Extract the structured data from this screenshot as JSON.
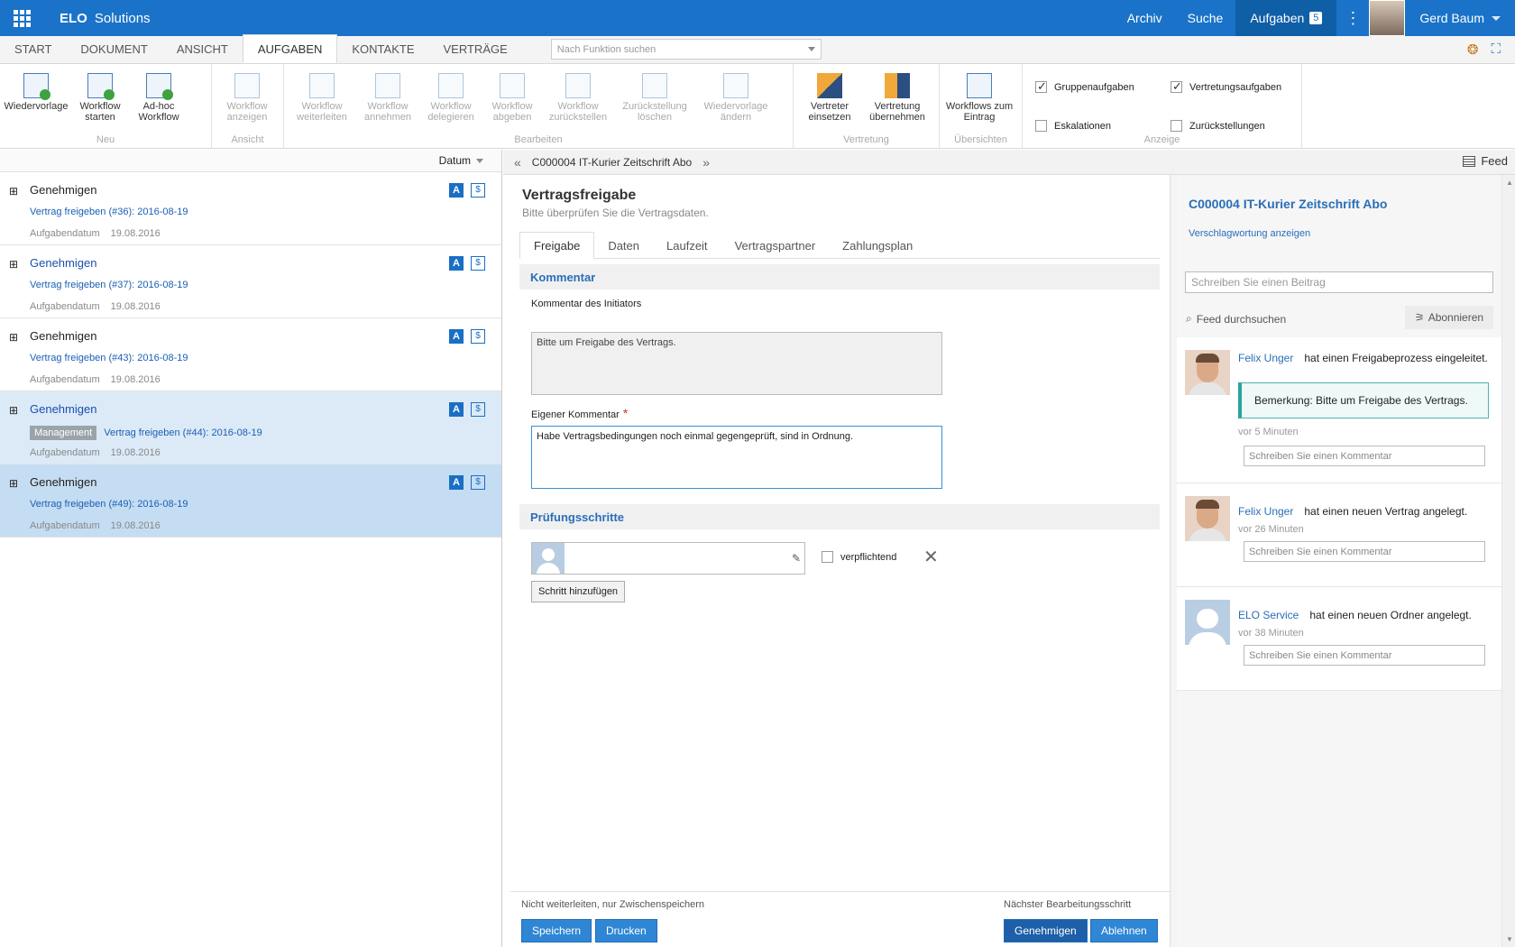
{
  "app": {
    "brand": "ELO",
    "title": "Solutions"
  },
  "topnav": {
    "archiv": "Archiv",
    "suche": "Suche",
    "aufgaben": "Aufgaben",
    "aufgaben_count": "5",
    "user": "Gerd Baum"
  },
  "ribbon_tabs": [
    "START",
    "DOKUMENT",
    "ANSICHT",
    "AUFGABEN",
    "KONTAKTE",
    "VERTRÄGE"
  ],
  "function_search": {
    "placeholder": "Nach Funktion suchen"
  },
  "ribbon": {
    "groups": {
      "neu": "Neu",
      "ansicht": "Ansicht",
      "bearbeiten": "Bearbeiten",
      "vertretung": "Vertretung",
      "uebersichten": "Übersichten",
      "anzeige": "Anzeige"
    },
    "buttons": {
      "wiedervorlage": "Wiedervorlage",
      "workflow_starten": "Workflow starten",
      "adhoc": "Ad-hoc Workflow",
      "wf_anzeigen": "Workflow anzeigen",
      "wf_weiterleiten": "Workflow weiterleiten",
      "wf_annehmen": "Workflow annehmen",
      "wf_delegieren": "Workflow delegieren",
      "wf_abgeben": "Workflow abgeben",
      "wf_zurueckstellen": "Workflow zurückstellen",
      "zurueck_loeschen": "Zurückstellung löschen",
      "wv_aendern": "Wiedervorlage ändern",
      "vertreter": "Vertreter einsetzen",
      "vertretung_ueb": "Vertretung übernehmen",
      "wf_eintrag": "Workflows zum Eintrag"
    },
    "checks": {
      "gruppen": "Gruppenaufgaben",
      "vertretung": "Vertretungsaufgaben",
      "eskalationen": "Eskalationen",
      "zurueck": "Zurückstellungen"
    }
  },
  "list": {
    "sort_label": "Datum",
    "date_label": "Aufgabendatum",
    "items": [
      {
        "title": "Genehmigen",
        "sub": "Vertrag freigeben (#36): 2016-08-19",
        "date": "19.08.2016",
        "tag": ""
      },
      {
        "title": "Genehmigen",
        "sub": "Vertrag freigeben (#37): 2016-08-19",
        "date": "19.08.2016",
        "tag": ""
      },
      {
        "title": "Genehmigen",
        "sub": "Vertrag freigeben (#43): 2016-08-19",
        "date": "19.08.2016",
        "tag": ""
      },
      {
        "title": "Genehmigen",
        "sub": "Vertrag freigeben (#44): 2016-08-19",
        "date": "19.08.2016",
        "tag": "Management"
      },
      {
        "title": "Genehmigen",
        "sub": "Vertrag freigeben (#49): 2016-08-19",
        "date": "19.08.2016",
        "tag": ""
      }
    ]
  },
  "crumb": {
    "title": "C000004 IT-Kurier Zeitschrift Abo",
    "feed": "Feed"
  },
  "form": {
    "title": "Vertragsfreigabe",
    "subtitle": "Bitte überprüfen Sie die Vertragsdaten.",
    "tabs": [
      "Freigabe",
      "Daten",
      "Laufzeit",
      "Vertragspartner",
      "Zahlungsplan"
    ],
    "sec_kommentar": "Kommentar",
    "init_label": "Kommentar des Initiators",
    "init_value": "Bitte um Freigabe des Vertrags.",
    "own_label": "Eigener Kommentar",
    "own_value": "Habe Vertragsbedingungen noch einmal gegengeprüft, sind in Ordnung.",
    "sec_pruef": "Prüfungsschritte",
    "verpflichtend": "verpflichtend",
    "add_step": "Schritt hinzufügen",
    "footer_left": "Nicht weiterleiten, nur Zwischenspeichern",
    "footer_right": "Nächster Bearbeitungsschritt",
    "speichern": "Speichern",
    "drucken": "Drucken",
    "genehmigen": "Genehmigen",
    "ablehnen": "Ablehnen"
  },
  "feed": {
    "title": "C000004 IT-Kurier Zeitschrift Abo",
    "tags_link": "Verschlagwortung anzeigen",
    "post_placeholder": "Schreiben Sie einen Beitrag",
    "search": "Feed durchsuchen",
    "subscribe": "Abonnieren",
    "comment_placeholder": "Schreiben Sie einen Kommentar",
    "items": [
      {
        "name": "Felix Unger",
        "text": "hat einen Freigabeprozess eingeleitet.",
        "remark": "Bemerkung: Bitte um Freigabe des Vertrags.",
        "time": "vor 5 Minuten"
      },
      {
        "name": "Felix Unger",
        "text": "hat einen neuen Vertrag angelegt.",
        "time": "vor 26 Minuten"
      },
      {
        "name": "ELO Service",
        "text": "hat einen neuen Ordner angelegt.",
        "time": "vor 38 Minuten"
      }
    ]
  },
  "colors": {
    "accent": "#1a73c8",
    "link": "#2a6eb8",
    "selected": "#c5ddf2",
    "remark_border": "#26a69a"
  }
}
